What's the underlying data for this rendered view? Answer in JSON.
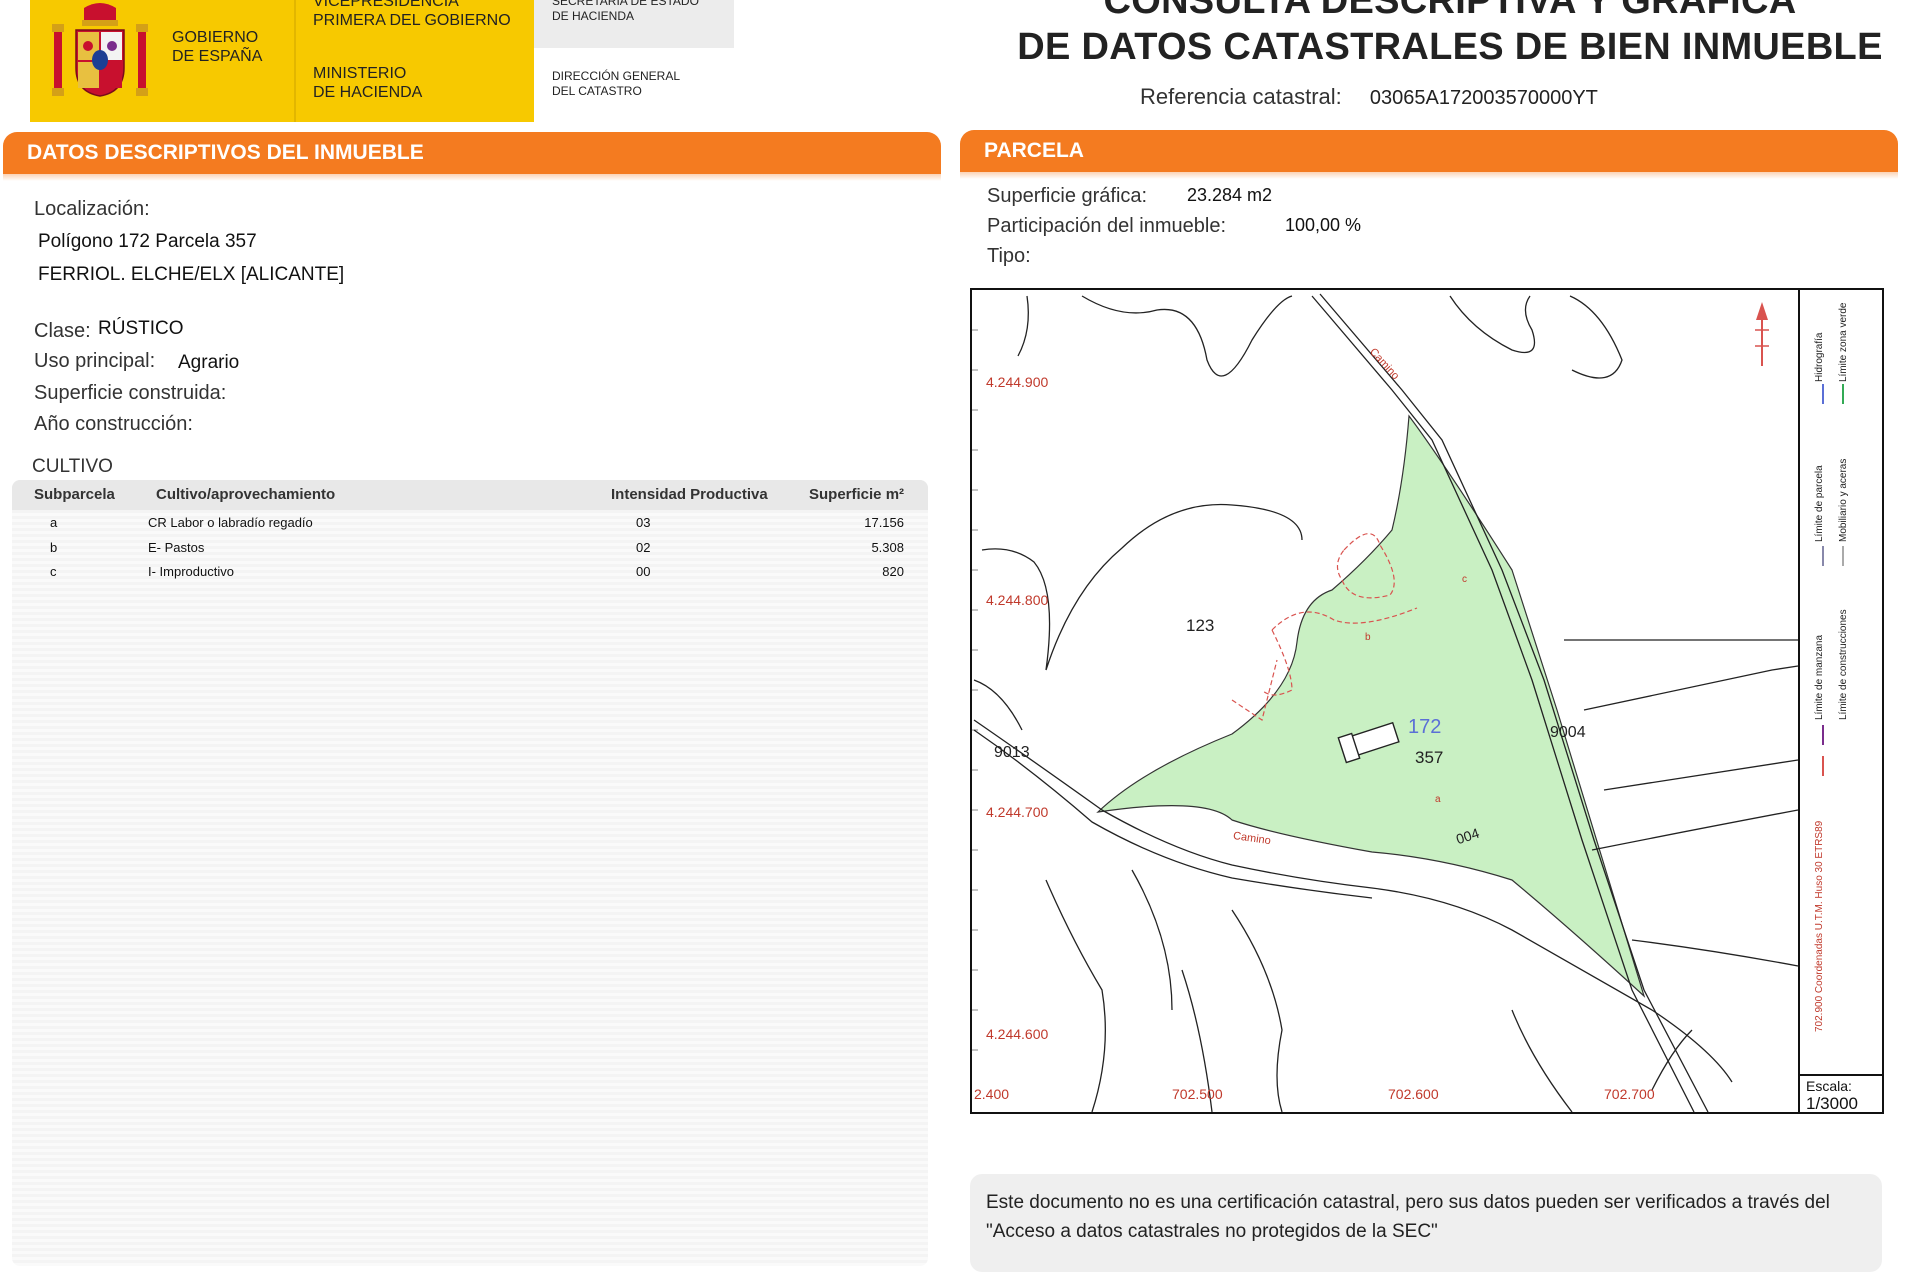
{
  "header": {
    "gobierno": [
      "Gobierno",
      "de España"
    ],
    "vicepresidencia": [
      "Vicepresidencia",
      "Primera del Gobierno"
    ],
    "ministerio": [
      "Ministerio",
      "de Hacienda"
    ],
    "secretaria": [
      "Secretaría de Estado",
      "de Hacienda"
    ],
    "direccion": [
      "Dirección General",
      "del Catastro"
    ],
    "title_line1": "CONSULTA DESCRIPTIVA Y GRÁFICA",
    "title_line2": "DE DATOS CATASTRALES DE BIEN INMUEBLE",
    "ref_label": "Referencia catastral:",
    "ref_value": "03065A172003570000YT"
  },
  "left": {
    "section_title": "DATOS DESCRIPTIVOS DEL INMUEBLE",
    "localizacion_label": "Localización:",
    "localizacion_line1": "Polígono 172 Parcela 357",
    "localizacion_line2": "FERRIOL. ELCHE/ELX [ALICANTE]",
    "clase_label": "Clase:",
    "clase_value": "RÚSTICO",
    "uso_label": "Uso principal:",
    "uso_value": "Agrario",
    "superficie_label": "Superficie construida:",
    "anio_label": "Año construcción:",
    "cultivo_title": "CULTIVO",
    "table": {
      "headers": [
        "Subparcela",
        "Cultivo/aprovechamiento",
        "Intensidad Productiva",
        "Superficie m²"
      ],
      "rows": [
        [
          "a",
          "CR Labor o labradío regadío",
          "03",
          "17.156"
        ],
        [
          "b",
          "E- Pastos",
          "02",
          "5.308"
        ],
        [
          "c",
          "I- Improductivo",
          "00",
          "820"
        ]
      ]
    }
  },
  "right": {
    "section_title": "PARCELA",
    "sup_grafica_label": "Superficie gráfica:",
    "sup_grafica_value": "23.284 m2",
    "participacion_label": "Participación del inmueble:",
    "participacion_value": "100,00 %",
    "tipo_label": "Tipo:",
    "map": {
      "y_coords": [
        "4.244.900",
        "4.244.800",
        "4.244.700",
        "4.244.600"
      ],
      "x_coords": [
        "2.400",
        "702.500",
        "702.600",
        "702.700"
      ],
      "camino_labels": [
        "Camino",
        "Camino"
      ],
      "parcel_labels": [
        "123",
        "172",
        "357",
        "9013",
        "9004",
        "004"
      ],
      "subparcel_labels": [
        "a",
        "b",
        "c"
      ],
      "legend": [
        "Límite de manzana",
        "Límite de construcciones",
        "Límite de parcela",
        "Mobiliario y aceras",
        "Hidrografía",
        "Límite zona verde"
      ],
      "coord_note": "702.900 Coordenadas U.T.M. Huso 30 ETRS89",
      "scale_label": "Escala:",
      "scale_value": "1/3000",
      "colors": {
        "parcel_fill": "#c9f0c3",
        "label_red": "#c0392b",
        "label_blue": "#5b6fd6"
      }
    },
    "note": "Este documento no es una certificación catastral, pero sus datos pueden ser verificados a través del \"Acceso a datos catastrales no protegidos de la SEC\""
  }
}
